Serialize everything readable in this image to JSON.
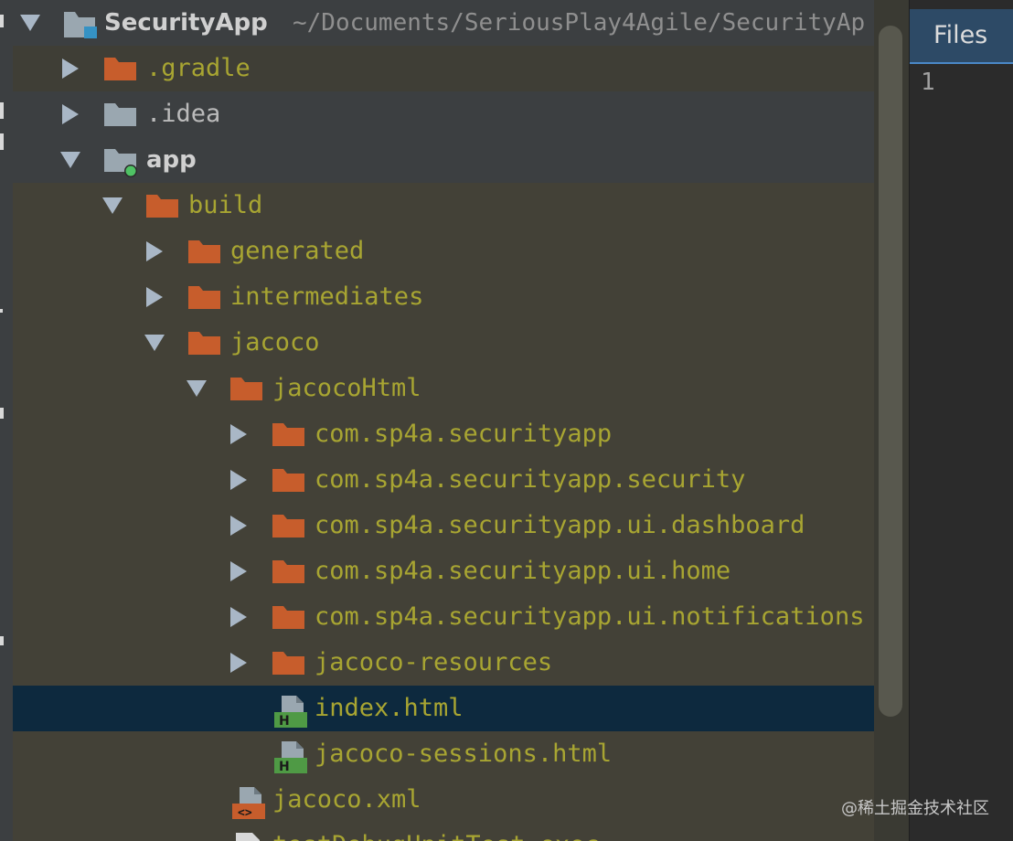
{
  "colors": {
    "tree_bg": "#434137",
    "selected_row": "#0d293e",
    "folder_orange": "#c75d2c",
    "folder_grey": "#9aa7b0",
    "file_label": "#a8a532",
    "html_icon_green": "#4f9a45"
  },
  "project": {
    "name": "SecurityApp",
    "path": "~/Documents/SeriousPlay4Agile/SecurityAp"
  },
  "tree": [
    {
      "label": ".gradle",
      "icon": "folder-icon",
      "state": "collapsed"
    },
    {
      "label": ".idea",
      "icon": "folder-icon",
      "state": "collapsed"
    },
    {
      "label": "app",
      "icon": "module-folder-icon",
      "state": "expanded"
    },
    {
      "label": "build",
      "icon": "folder-icon",
      "state": "expanded"
    },
    {
      "label": "generated",
      "icon": "folder-icon",
      "state": "collapsed"
    },
    {
      "label": "intermediates",
      "icon": "folder-icon",
      "state": "collapsed"
    },
    {
      "label": "jacoco",
      "icon": "folder-icon",
      "state": "expanded"
    },
    {
      "label": "jacocoHtml",
      "icon": "folder-icon",
      "state": "expanded"
    },
    {
      "label": "com.sp4a.securityapp",
      "icon": "folder-icon",
      "state": "collapsed"
    },
    {
      "label": "com.sp4a.securityapp.security",
      "icon": "folder-icon",
      "state": "collapsed"
    },
    {
      "label": "com.sp4a.securityapp.ui.dashboard",
      "icon": "folder-icon",
      "state": "collapsed"
    },
    {
      "label": "com.sp4a.securityapp.ui.home",
      "icon": "folder-icon",
      "state": "collapsed"
    },
    {
      "label": "com.sp4a.securityapp.ui.notifications",
      "icon": "folder-icon",
      "state": "collapsed"
    },
    {
      "label": "jacoco-resources",
      "icon": "folder-icon",
      "state": "collapsed"
    },
    {
      "label": "index.html",
      "icon": "html-file-icon",
      "state": "selected"
    },
    {
      "label": "jacoco-sessions.html",
      "icon": "html-file-icon",
      "state": "leaf"
    },
    {
      "label": "jacoco.xml",
      "icon": "xml-file-icon",
      "state": "leaf"
    },
    {
      "label": "testDebugUnitTest.exec",
      "icon": "file-icon",
      "state": "leaf"
    }
  ],
  "editor": {
    "tab_label": "Files",
    "line_number": "1"
  },
  "watermark": "@稀土掘金技术社区"
}
